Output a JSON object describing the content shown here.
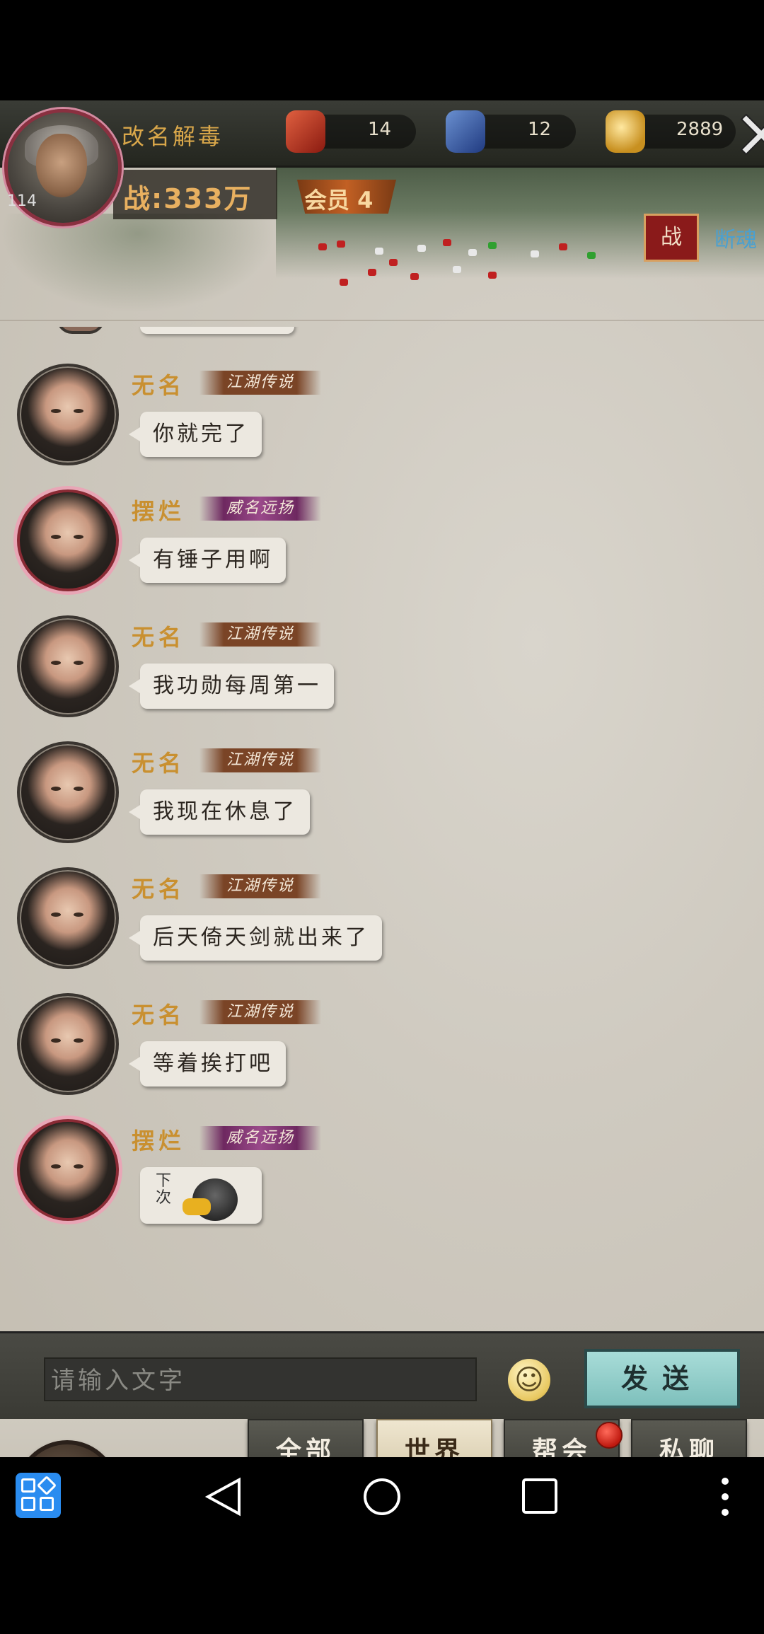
{
  "player": {
    "name": "改名解毒",
    "level": "114",
    "power": "战:333万",
    "vip": "会员 4"
  },
  "resources": [
    {
      "icon": "red-token-icon",
      "value": "14"
    },
    {
      "icon": "blue-token-icon",
      "value": "12"
    },
    {
      "icon": "gold-ingot-icon",
      "value": "2889"
    }
  ],
  "map": {
    "war_button": "战",
    "side_label": "断魂"
  },
  "messages": [
    {
      "name": "无名",
      "title": "江湖传说",
      "text": "你就完了",
      "avatar": "female-avatar"
    },
    {
      "name": "摆烂",
      "title": "威名远扬",
      "text": "有锤子用啊",
      "avatar": "flower-avatar"
    },
    {
      "name": "无名",
      "title": "江湖传说",
      "text": "我功勋每周第一",
      "avatar": "female-avatar"
    },
    {
      "name": "无名",
      "title": "江湖传说",
      "text": "我现在休息了",
      "avatar": "female-avatar"
    },
    {
      "name": "无名",
      "title": "江湖传说",
      "text": "后天倚天剑就出来了",
      "avatar": "female-avatar"
    },
    {
      "name": "无名",
      "title": "江湖传说",
      "text": "等着挨打吧",
      "avatar": "female-avatar"
    },
    {
      "name": "摆烂",
      "title": "威名远扬",
      "sticker_text": "下次",
      "avatar": "flower-avatar"
    }
  ],
  "input": {
    "placeholder": "请输入文字",
    "send_label": "发送",
    "emoji_icon": "smiley-icon"
  },
  "tabs": [
    {
      "label": "全部",
      "active": false
    },
    {
      "label": "世界",
      "active": true
    },
    {
      "label": "帮会",
      "active": false,
      "notification": true
    },
    {
      "label": "私聊",
      "active": false
    }
  ],
  "colors": {
    "name_gold": "#c99030",
    "send_button": "#a8dcd8",
    "notification_red": "#c01a10",
    "nav_blue": "#2a8cf0"
  }
}
